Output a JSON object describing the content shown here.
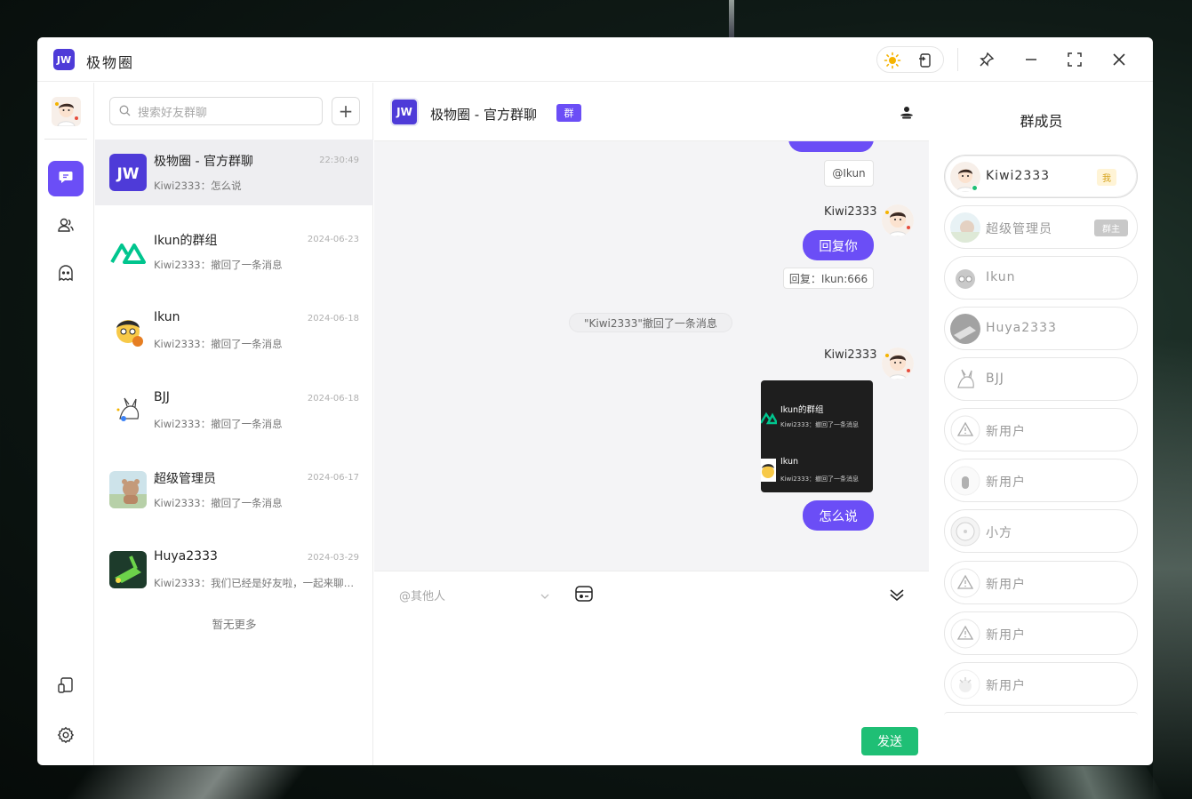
{
  "app": {
    "logo_text": "JW",
    "title": "极物圈"
  },
  "titlebar": {
    "icons": [
      "sun-icon",
      "screenshot-icon",
      "pin-icon",
      "minimize-icon",
      "maximize-icon",
      "close-icon"
    ],
    "sun_color": "#f5b301"
  },
  "nav": {
    "items": [
      "chat-icon",
      "contacts-icon",
      "ghost-icon"
    ],
    "bottom_items": [
      "device-icon",
      "settings-icon"
    ],
    "accent": "#6b4ef6"
  },
  "search": {
    "placeholder": "搜索好友群聊",
    "add_label": "+"
  },
  "conversations": [
    {
      "name": "极物圈 - 官方群聊",
      "time": "22:30:49",
      "last": "Kiwi2333：怎么说"
    },
    {
      "name": "Ikun的群组",
      "time": "2024-06-23",
      "last": "Kiwi2333：撤回了一条消息"
    },
    {
      "name": "Ikun",
      "time": "2024-06-18",
      "last": "Kiwi2333：撤回了一条消息"
    },
    {
      "name": "BJJ",
      "time": "2024-06-18",
      "last": "Kiwi2333：撤回了一条消息"
    },
    {
      "name": "超级管理员",
      "time": "2024-06-17",
      "last": "Kiwi2333：撤回了一条消息"
    },
    {
      "name": "Huya2333",
      "time": "2024-03-29",
      "last": "Kiwi2333：我们已经是好友啦，一起来聊天吧！"
    }
  ],
  "no_more": "暂无更多",
  "chat": {
    "title": "极物圈 - 官方群聊",
    "badge": "群",
    "avatar_text": "JW",
    "messages": {
      "reply_tag_top": "@Ikun",
      "sender1": "Kiwi2333",
      "bubble1": "回复你",
      "reply_tag1": "回复：Ikun:666",
      "system_note": "\"Kiwi2333\"撤回了一条消息",
      "sender2": "Kiwi2333",
      "image_rows": [
        {
          "name": "Ikun的群组",
          "msg": "Kiwi2333：撤回了一条消息"
        },
        {
          "name": "Ikun",
          "msg": "Kiwi2333：撤回了一条消息"
        }
      ],
      "bubble2": "怎么说"
    }
  },
  "composer": {
    "mention_placeholder": "@其他人",
    "send_label": "发送"
  },
  "members": {
    "title": "群成员",
    "list": [
      {
        "name": "Kiwi2333",
        "badge": "我",
        "online": true
      },
      {
        "name": "超级管理员",
        "badge": "群主",
        "online": false
      },
      {
        "name": "Ikun",
        "badge": "",
        "online": false
      },
      {
        "name": "Huya2333",
        "badge": "",
        "online": false
      },
      {
        "name": "BJJ",
        "badge": "",
        "online": false
      },
      {
        "name": "新用户",
        "badge": "",
        "online": false
      },
      {
        "name": "新用户",
        "badge": "",
        "online": false
      },
      {
        "name": "小方",
        "badge": "",
        "online": false
      },
      {
        "name": "新用户",
        "badge": "",
        "online": false
      },
      {
        "name": "新用户",
        "badge": "",
        "online": false
      },
      {
        "name": "新用户",
        "badge": "",
        "online": false
      }
    ]
  }
}
